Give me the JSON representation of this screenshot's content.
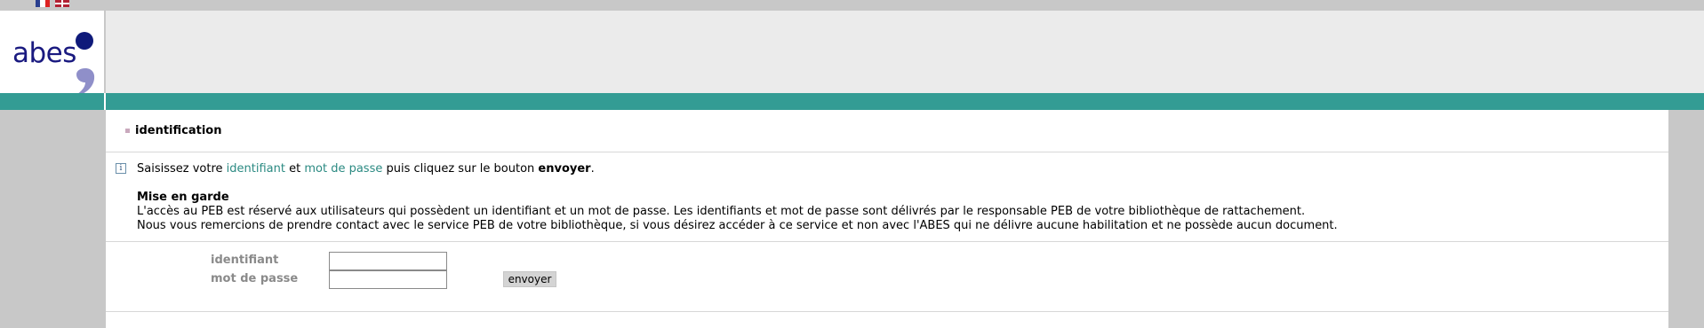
{
  "language_flags": [
    {
      "icon": "flag-fr-icon",
      "language": "français"
    },
    {
      "icon": "flag-en-icon",
      "language": "english"
    }
  ],
  "logo": {
    "text": "abes",
    "colors": {
      "text": "#1a1a80",
      "dot": "#0f1a7a",
      "comma": "#8f8fc9"
    }
  },
  "colors": {
    "accent": "#339c94",
    "link": "#2b8a82",
    "page_bg": "#c8c8c8",
    "header_bg": "#ebebeb"
  },
  "section": {
    "title": "identification"
  },
  "instructions": {
    "prefix": "Saisissez votre ",
    "identifiant_link": "identifiant",
    "et": " et ",
    "password_link": "mot de passe",
    "middle": " puis cliquez sur le bouton ",
    "button_name": "envoyer",
    "suffix": "."
  },
  "warning": {
    "title": "Mise en garde",
    "line1": "L'accès au PEB est réservé aux utilisateurs qui possèdent un identifiant et un mot de passe. Les identifiants et mot de passe sont délivrés par le responsable PEB de votre bibliothèque de rattachement.",
    "line2": "Nous vous remercions de prendre contact avec le service PEB de votre bibliothèque, si vous désirez accéder à ce service et non avec l'ABES qui ne délivre aucune habilitation et ne possède aucun document."
  },
  "form": {
    "identifiant_label": "identifiant",
    "identifiant_value": "",
    "password_label": "mot de passe",
    "password_value": "",
    "submit_label": "envoyer"
  }
}
